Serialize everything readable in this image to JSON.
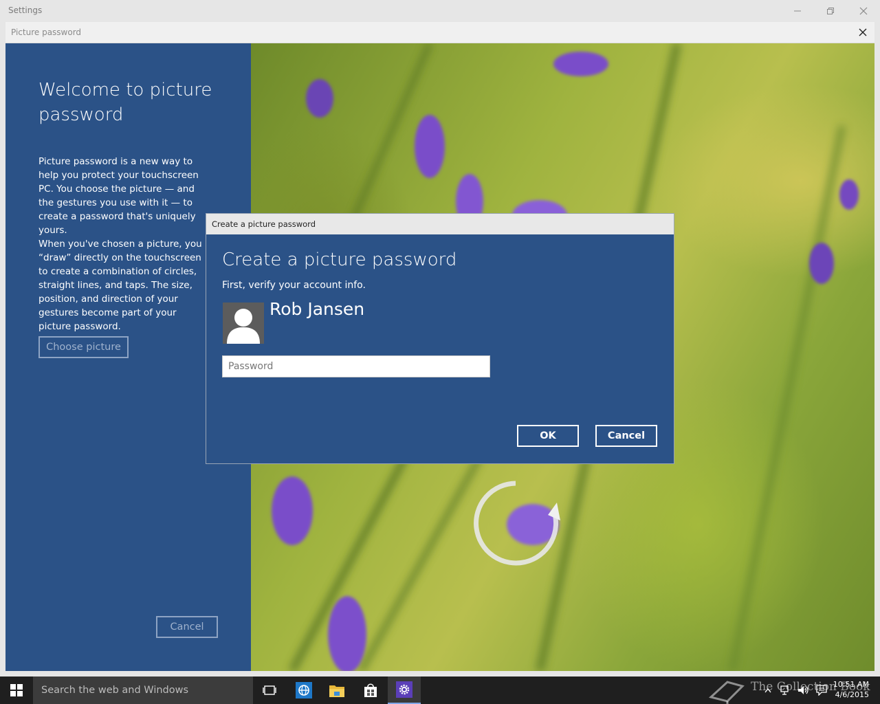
{
  "settings_window": {
    "title": "Settings"
  },
  "picture_password_window": {
    "title": "Picture password",
    "welcome_title": "Welcome to picture password",
    "intro_paragraph_1": "Picture password is a new way to help you protect your touchscreen PC. You choose the picture — and the gestures you use with it — to create a password that's uniquely yours.",
    "intro_paragraph_2": "When you've chosen a picture, you “draw” directly on the touchscreen to create a combination of circles, straight lines, and taps. The size, position, and direction of your gestures become part of your picture password.",
    "choose_picture_label": "Choose picture",
    "cancel_label": "Cancel"
  },
  "dialog": {
    "title": "Create a picture password",
    "heading": "Create a picture password",
    "subtitle": "First, verify your account info.",
    "user_name": "Rob Jansen",
    "password_placeholder": "Password",
    "password_value": "",
    "ok_label": "OK",
    "cancel_label": "Cancel",
    "accent_color": "#2b5287"
  },
  "taskbar": {
    "search_placeholder": "Search the web and Windows",
    "icons": [
      "windows-logo-icon",
      "task-view-icon",
      "internet-explorer-icon",
      "file-explorer-icon",
      "store-icon",
      "settings-gear-icon"
    ],
    "tray_icons": [
      "show-hidden-icons-chevron",
      "network-icon",
      "volume-icon",
      "action-center-icon"
    ],
    "time": "10:51 AM",
    "date": "4/6/2015",
    "watermark": "The Collection Book"
  }
}
